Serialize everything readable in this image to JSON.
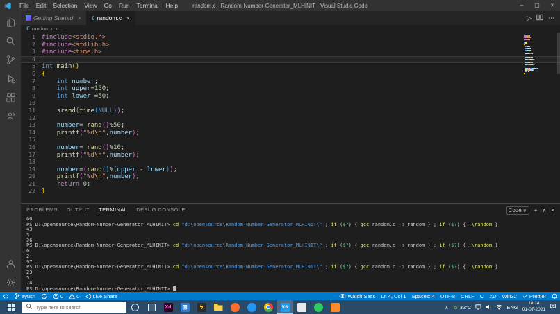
{
  "window": {
    "title": "random.c - Random-Number-Generator_MLHINIT - Visual Studio Code",
    "menus": [
      "File",
      "Edit",
      "Selection",
      "View",
      "Go",
      "Run",
      "Terminal",
      "Help"
    ]
  },
  "tabs": {
    "items": [
      {
        "label": "Getting Started",
        "icon": "getting-started",
        "active": false
      },
      {
        "label": "random.c",
        "icon": "c-file",
        "active": true
      }
    ]
  },
  "breadcrumb": {
    "file": "random.c",
    "more": "..."
  },
  "editor": {
    "lines": [
      {
        "n": "1",
        "segs": [
          [
            "p",
            "#include"
          ],
          [
            "s",
            "<stdio.h>"
          ]
        ]
      },
      {
        "n": "2",
        "segs": [
          [
            "p",
            "#include"
          ],
          [
            "s",
            "<stdlib.h>"
          ]
        ]
      },
      {
        "n": "3",
        "segs": [
          [
            "p",
            "#include"
          ],
          [
            "s",
            "<time.h>"
          ]
        ]
      },
      {
        "n": "4",
        "cur": true,
        "segs": []
      },
      {
        "n": "5",
        "segs": [
          [
            "k",
            "int"
          ],
          [
            "w",
            " "
          ],
          [
            "f",
            "main"
          ],
          [
            "b1",
            "()"
          ]
        ]
      },
      {
        "n": "6",
        "segs": [
          [
            "b1",
            "{"
          ]
        ]
      },
      {
        "n": "7",
        "segs": [
          [
            "w",
            "    "
          ],
          [
            "k",
            "int"
          ],
          [
            "w",
            " "
          ],
          [
            "v",
            "number"
          ],
          [
            "w",
            ";"
          ]
        ]
      },
      {
        "n": "8",
        "segs": [
          [
            "w",
            "    "
          ],
          [
            "k",
            "int"
          ],
          [
            "w",
            " "
          ],
          [
            "v",
            "upper"
          ],
          [
            "w",
            "="
          ],
          [
            "n",
            "150"
          ],
          [
            "w",
            ";"
          ]
        ]
      },
      {
        "n": "9",
        "segs": [
          [
            "w",
            "    "
          ],
          [
            "k",
            "int"
          ],
          [
            "w",
            " "
          ],
          [
            "v",
            "lower"
          ],
          [
            "w",
            " ="
          ],
          [
            "n",
            "50"
          ],
          [
            "w",
            ";"
          ]
        ]
      },
      {
        "n": "10",
        "segs": []
      },
      {
        "n": "11",
        "segs": [
          [
            "w",
            "    "
          ],
          [
            "f",
            "srand"
          ],
          [
            "b2",
            "("
          ],
          [
            "f",
            "time"
          ],
          [
            "b3",
            "("
          ],
          [
            "k",
            "NULL"
          ],
          [
            "b3",
            ")"
          ],
          [
            "b2",
            ")"
          ],
          [
            "w",
            ";"
          ]
        ]
      },
      {
        "n": "12",
        "segs": []
      },
      {
        "n": "13",
        "segs": [
          [
            "w",
            "    "
          ],
          [
            "v",
            "number"
          ],
          [
            "w",
            "= "
          ],
          [
            "f",
            "rand"
          ],
          [
            "b2",
            "()"
          ],
          [
            "w",
            "%"
          ],
          [
            "n",
            "50"
          ],
          [
            "w",
            ";"
          ]
        ]
      },
      {
        "n": "14",
        "segs": [
          [
            "w",
            "    "
          ],
          [
            "f",
            "printf"
          ],
          [
            "b2",
            "("
          ],
          [
            "s",
            "\"%d"
          ],
          [
            "e",
            "\\n"
          ],
          [
            "s",
            "\""
          ],
          [
            "w",
            ","
          ],
          [
            "v",
            "number"
          ],
          [
            "b2",
            ")"
          ],
          [
            "w",
            ";"
          ]
        ]
      },
      {
        "n": "15",
        "segs": []
      },
      {
        "n": "16",
        "segs": [
          [
            "w",
            "    "
          ],
          [
            "v",
            "number"
          ],
          [
            "w",
            "= "
          ],
          [
            "f",
            "rand"
          ],
          [
            "b2",
            "()"
          ],
          [
            "w",
            "%"
          ],
          [
            "n",
            "10"
          ],
          [
            "w",
            ";"
          ]
        ]
      },
      {
        "n": "17",
        "segs": [
          [
            "w",
            "    "
          ],
          [
            "f",
            "printf"
          ],
          [
            "b2",
            "("
          ],
          [
            "s",
            "\"%d"
          ],
          [
            "e",
            "\\n"
          ],
          [
            "s",
            "\""
          ],
          [
            "w",
            ","
          ],
          [
            "v",
            "number"
          ],
          [
            "b2",
            ")"
          ],
          [
            "w",
            ";"
          ]
        ]
      },
      {
        "n": "18",
        "segs": []
      },
      {
        "n": "19",
        "segs": [
          [
            "w",
            "    "
          ],
          [
            "v",
            "number"
          ],
          [
            "w",
            "="
          ],
          [
            "b2",
            "("
          ],
          [
            "f",
            "rand"
          ],
          [
            "b3",
            "()"
          ],
          [
            "w",
            "%"
          ],
          [
            "b3",
            "("
          ],
          [
            "v",
            "upper"
          ],
          [
            "w",
            " - "
          ],
          [
            "v",
            "lower"
          ],
          [
            "b3",
            ")"
          ],
          [
            "b2",
            ")"
          ],
          [
            "w",
            ";"
          ]
        ]
      },
      {
        "n": "20",
        "segs": [
          [
            "w",
            "    "
          ],
          [
            "f",
            "printf"
          ],
          [
            "b2",
            "("
          ],
          [
            "s",
            "\"%d"
          ],
          [
            "e",
            "\\n"
          ],
          [
            "s",
            "\""
          ],
          [
            "w",
            ","
          ],
          [
            "v",
            "number"
          ],
          [
            "b2",
            ")"
          ],
          [
            "w",
            ";"
          ]
        ]
      },
      {
        "n": "21",
        "segs": [
          [
            "w",
            "    "
          ],
          [
            "p",
            "return"
          ],
          [
            "w",
            " "
          ],
          [
            "n",
            "0"
          ],
          [
            "w",
            ";"
          ]
        ]
      },
      {
        "n": "22",
        "segs": [
          [
            "b1",
            "}"
          ]
        ]
      }
    ]
  },
  "panel": {
    "tabs": [
      {
        "label": "PROBLEMS",
        "active": false
      },
      {
        "label": "OUTPUT",
        "active": false
      },
      {
        "label": "TERMINAL",
        "active": true
      },
      {
        "label": "DEBUG CONSOLE",
        "active": false
      }
    ],
    "shell": "Code",
    "lines": [
      [
        [
          "o",
          "60"
        ]
      ],
      [
        [
          "pr",
          "PS D:\\opensource\\Random-Number-Generator_MLHINIT>"
        ],
        [
          "tw",
          " "
        ],
        [
          "y",
          "cd"
        ],
        [
          "tw",
          " "
        ],
        [
          "bl",
          "\"d:\\opensource\\Random-Number-Generator_MLHINIT\\\""
        ],
        [
          "tw",
          " ; "
        ],
        [
          "y",
          "if"
        ],
        [
          "tw",
          " ("
        ],
        [
          "g",
          "$?"
        ],
        [
          "tw",
          ") { "
        ],
        [
          "y",
          "gcc"
        ],
        [
          "tw",
          " random.c "
        ],
        [
          "gr",
          "-o"
        ],
        [
          "tw",
          " random } ; "
        ],
        [
          "y",
          "if"
        ],
        [
          "tw",
          " ("
        ],
        [
          "g",
          "$?"
        ],
        [
          "tw",
          ") { "
        ],
        [
          "y",
          ".\\random"
        ],
        [
          "tw",
          " }"
        ]
      ],
      [
        [
          "o",
          "43"
        ]
      ],
      [
        [
          "o",
          "3"
        ]
      ],
      [
        [
          "o",
          "36"
        ]
      ],
      [
        [
          "pr",
          "PS D:\\opensource\\Random-Number-Generator_MLHINIT>"
        ],
        [
          "tw",
          " "
        ],
        [
          "y",
          "cd"
        ],
        [
          "tw",
          " "
        ],
        [
          "bl",
          "\"d:\\opensource\\Random-Number-Generator_MLHINIT\\\""
        ],
        [
          "tw",
          " ; "
        ],
        [
          "y",
          "if"
        ],
        [
          "tw",
          " ("
        ],
        [
          "g",
          "$?"
        ],
        [
          "tw",
          ") { "
        ],
        [
          "y",
          "gcc"
        ],
        [
          "tw",
          " random.c "
        ],
        [
          "gr",
          "-o"
        ],
        [
          "tw",
          " random } ; "
        ],
        [
          "y",
          "if"
        ],
        [
          "tw",
          " ("
        ],
        [
          "g",
          "$?"
        ],
        [
          "tw",
          ") { "
        ],
        [
          "y",
          ".\\random"
        ],
        [
          "tw",
          " }"
        ]
      ],
      [
        [
          "o",
          "0"
        ]
      ],
      [
        [
          "o",
          "2"
        ]
      ],
      [
        [
          "o",
          "97"
        ]
      ],
      [
        [
          "pr",
          "PS D:\\opensource\\Random-Number-Generator_MLHINIT>"
        ],
        [
          "tw",
          " "
        ],
        [
          "y",
          "cd"
        ],
        [
          "tw",
          " "
        ],
        [
          "bl",
          "\"d:\\opensource\\Random-Number-Generator_MLHINIT\\\""
        ],
        [
          "tw",
          " ; "
        ],
        [
          "y",
          "if"
        ],
        [
          "tw",
          " ("
        ],
        [
          "g",
          "$?"
        ],
        [
          "tw",
          ") { "
        ],
        [
          "y",
          "gcc"
        ],
        [
          "tw",
          " random.c "
        ],
        [
          "gr",
          "-o"
        ],
        [
          "tw",
          " random } ; "
        ],
        [
          "y",
          "if"
        ],
        [
          "tw",
          " ("
        ],
        [
          "g",
          "$?"
        ],
        [
          "tw",
          ") { "
        ],
        [
          "y",
          ".\\random"
        ],
        [
          "tw",
          " }"
        ]
      ],
      [
        [
          "o",
          "23"
        ]
      ],
      [
        [
          "o",
          "5"
        ]
      ],
      [
        [
          "o",
          "74"
        ]
      ],
      [
        [
          "pr",
          "PS D:\\opensource\\Random-Number-Generator_MLHINIT>"
        ],
        [
          "tw",
          " "
        ],
        [
          "cur",
          ""
        ]
      ]
    ]
  },
  "status_bar": {
    "accent": "#007acc",
    "left": [
      {
        "name": "remote-window",
        "icon": "remote",
        "label": ""
      },
      {
        "name": "git-branch",
        "icon": "branch",
        "label": "ayush"
      },
      {
        "name": "sync-changes",
        "icon": "sync",
        "label": ""
      },
      {
        "name": "errors",
        "icon": "error",
        "label": "0"
      },
      {
        "name": "warnings",
        "icon": "warning",
        "label": "0"
      },
      {
        "name": "live-share",
        "icon": "liveshare",
        "label": "Live Share"
      }
    ],
    "right": [
      {
        "name": "watch-sass",
        "icon": "eye",
        "label": "Watch Sass"
      },
      {
        "name": "cursor-position",
        "label": "Ln 4, Col 1"
      },
      {
        "name": "indentation",
        "label": "Spaces: 4"
      },
      {
        "name": "encoding",
        "label": "UTF-8"
      },
      {
        "name": "eol",
        "label": "CRLF"
      },
      {
        "name": "language-mode",
        "label": "C"
      },
      {
        "name": "xd-extension",
        "label": "XD"
      },
      {
        "name": "platform",
        "label": "Win32"
      },
      {
        "name": "prettier",
        "icon": "check",
        "label": "Prettier"
      },
      {
        "name": "notifications",
        "icon": "bell",
        "label": ""
      }
    ]
  },
  "taskbar": {
    "search_placeholder": "Type here to search",
    "apps": [
      {
        "name": "cortana",
        "cls": "ic-cortana",
        "label": ""
      },
      {
        "name": "task-view",
        "cls": "ic-taskview",
        "label": ""
      },
      {
        "name": "adobe-xd",
        "cls": "ic-xd",
        "label": "Xd"
      },
      {
        "name": "store-app",
        "cls": "ic-grid",
        "label": "⊞"
      },
      {
        "name": "lightning-app",
        "cls": "ic-bolt",
        "label": "ϟ"
      },
      {
        "name": "file-explorer",
        "cls": "ic-folder",
        "label": ""
      },
      {
        "name": "browser-orange",
        "cls": "ic-orange",
        "label": ""
      },
      {
        "name": "messaging-app",
        "cls": "ic-blue",
        "label": ""
      },
      {
        "name": "chrome",
        "cls": "ic-chrome",
        "label": ""
      },
      {
        "name": "vscode",
        "cls": "ic-vscode",
        "label": "VS",
        "active": true
      },
      {
        "name": "notes-app",
        "cls": "ic-light",
        "label": ""
      },
      {
        "name": "whatsapp",
        "cls": "ic-whatsapp",
        "label": ""
      },
      {
        "name": "media-app",
        "cls": "ic-cone",
        "label": ""
      }
    ],
    "tray": {
      "temp": "32°C",
      "lang": "ENG",
      "time": "18:14",
      "date": "01-07-2021"
    }
  }
}
